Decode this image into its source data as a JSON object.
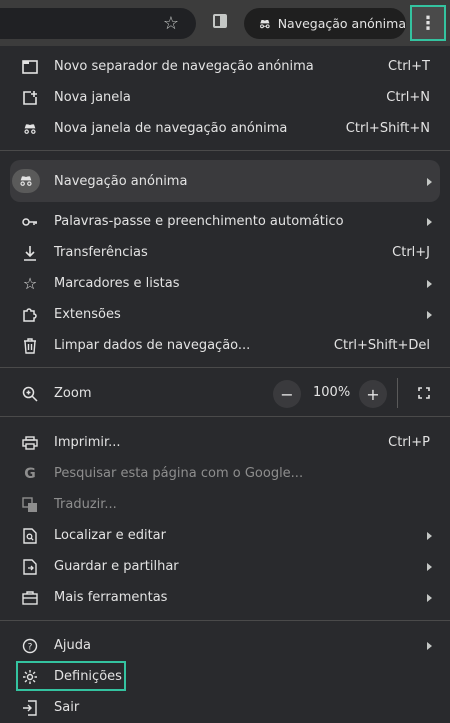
{
  "toolbar": {
    "incognito_label": "Navegação anónima"
  },
  "menu": {
    "new_tab": {
      "label": "Novo separador de navegação anónima",
      "shortcut": "Ctrl+T"
    },
    "new_window": {
      "label": "Nova janela",
      "shortcut": "Ctrl+N"
    },
    "new_incognito_window": {
      "label": "Nova janela de navegação anónima",
      "shortcut": "Ctrl+Shift+N"
    },
    "incognito_profile": {
      "label": "Navegação anónima"
    },
    "passwords": {
      "label": "Palavras-passe e preenchimento automático"
    },
    "downloads": {
      "label": "Transferências",
      "shortcut": "Ctrl+J"
    },
    "bookmarks": {
      "label": "Marcadores e listas"
    },
    "extensions": {
      "label": "Extensões"
    },
    "clear_data": {
      "label": "Limpar dados de navegação...",
      "shortcut": "Ctrl+Shift+Del"
    },
    "zoom": {
      "label": "Zoom",
      "minus": "−",
      "value": "100%",
      "plus": "+"
    },
    "print": {
      "label": "Imprimir...",
      "shortcut": "Ctrl+P"
    },
    "search_google": {
      "label": "Pesquisar esta página com o Google..."
    },
    "translate": {
      "label": "Traduzir..."
    },
    "find_edit": {
      "label": "Localizar e editar"
    },
    "save_share": {
      "label": "Guardar e partilhar"
    },
    "more_tools": {
      "label": "Mais ferramentas"
    },
    "help": {
      "label": "Ajuda"
    },
    "settings": {
      "label": "Definições"
    },
    "exit": {
      "label": "Sair"
    }
  },
  "colors": {
    "accent_highlight": "#34c3a0",
    "menu_bg": "#292a2d",
    "text": "#e3e3e3"
  }
}
